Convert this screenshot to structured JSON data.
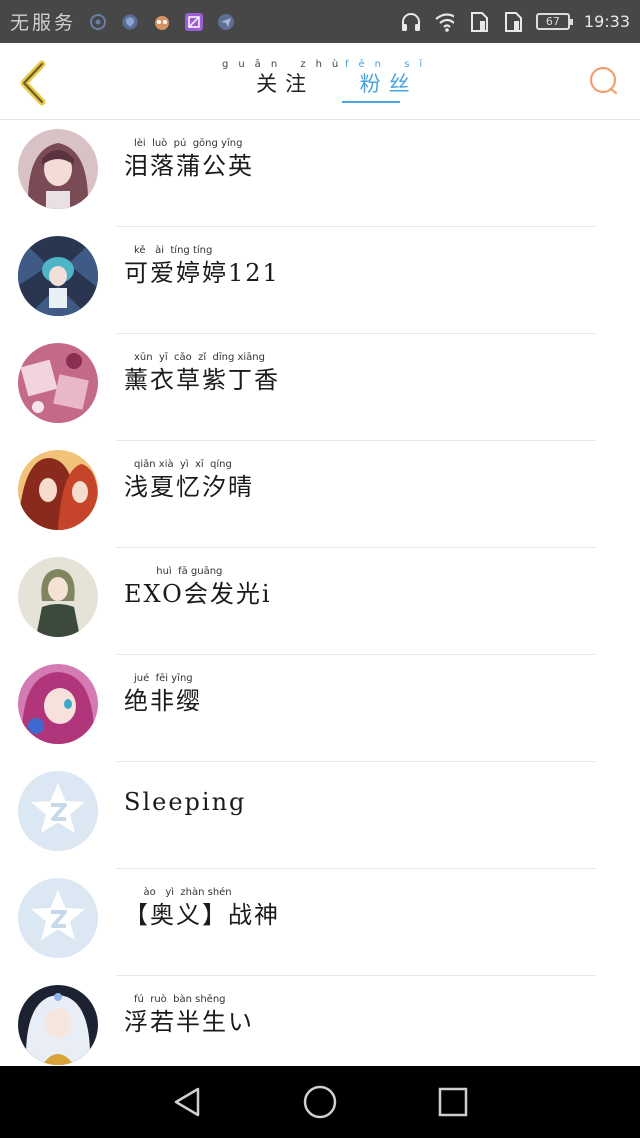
{
  "status_bar": {
    "carrier": "无服务",
    "battery": "67",
    "time": "19:33"
  },
  "header": {
    "tabs": [
      {
        "label": "关注",
        "pinyin": "guān zhù",
        "active": false
      },
      {
        "label": "粉丝",
        "pinyin": "fěn sī",
        "active": true
      }
    ],
    "accent_color": "#4aa3df",
    "back_color": "#e9c94a",
    "search_color": "#f2a070"
  },
  "fans": [
    {
      "name": "泪落蒲公英",
      "pinyin": "lèi  luò  pú  gōng yīng",
      "avatar": "avatar-pink-hair"
    },
    {
      "name": "可爱婷婷121",
      "pinyin": "kě   ài  tíng tíng",
      "avatar": "avatar-blue-character"
    },
    {
      "name": "薰衣草紫丁香",
      "pinyin": "xūn  yī  cǎo  zǐ  dīng xiāng",
      "avatar": "avatar-pink-pattern"
    },
    {
      "name": "浅夏忆汐晴",
      "pinyin": "qiǎn xià  yì  xī  qíng",
      "avatar": "avatar-red-hair"
    },
    {
      "name": "EXO会发光i",
      "pinyin": "       huì  fā guāng",
      "avatar": "avatar-green-girl"
    },
    {
      "name": "绝非缨",
      "pinyin": "jué  fēi yīng",
      "avatar": "avatar-purple-hair"
    },
    {
      "name": "Sleeping",
      "pinyin": "",
      "avatar": "avatar-default"
    },
    {
      "name": "【奥义】战神",
      "pinyin": "   ào   yì  zhàn shén",
      "avatar": "avatar-default"
    },
    {
      "name": "浮若半生い",
      "pinyin": "fú  ruò  bàn shēng",
      "avatar": "avatar-silver-hair"
    }
  ]
}
